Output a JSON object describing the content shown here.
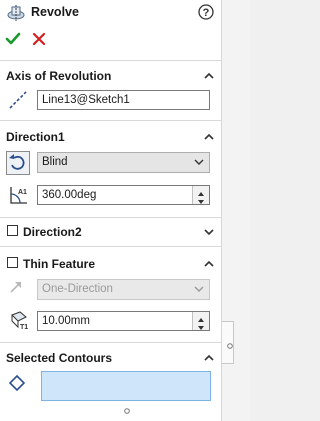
{
  "header": {
    "title": "Revolve",
    "help_icon": "question-circle-icon",
    "ok_icon": "green-check-icon",
    "cancel_icon": "red-x-icon"
  },
  "axis": {
    "title": "Axis of Revolution",
    "value": "Line13@Sketch1"
  },
  "direction1": {
    "title": "Direction1",
    "type": "Blind",
    "angle": "360.00deg"
  },
  "direction2": {
    "title": "Direction2"
  },
  "thin": {
    "title": "Thin Feature",
    "type": "One-Direction",
    "thickness": "10.00mm"
  },
  "contours": {
    "title": "Selected Contours"
  },
  "colors": {
    "check": "#1a9a2a",
    "cross": "#d42020",
    "selection_box": "#cfe5fa"
  }
}
